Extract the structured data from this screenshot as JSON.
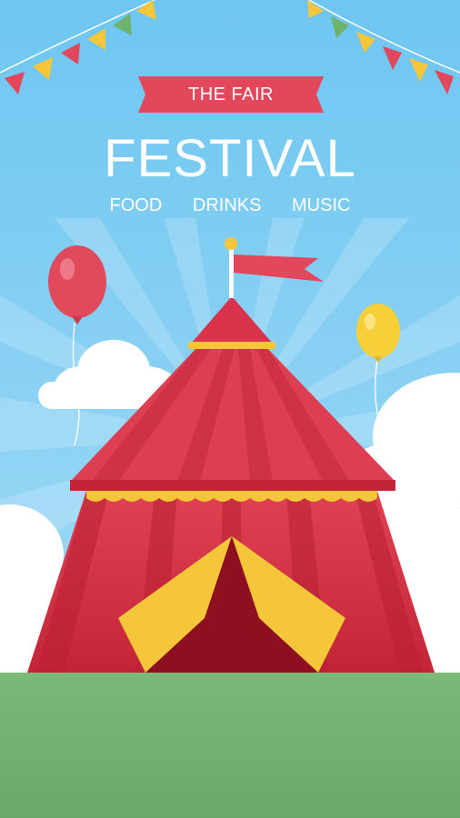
{
  "banner": {
    "label": "THE FAIR"
  },
  "headline": {
    "title": "FESTIVAL"
  },
  "taglines": [
    "FOOD",
    "DRINKS",
    "MUSIC"
  ],
  "colors": {
    "sky": "#6ec6f1",
    "grass": "#74b072",
    "tent_red": "#d8334a",
    "tent_yellow": "#f5c53a",
    "ribbon": "#e2475c",
    "balloon_red": "#e04a5c",
    "balloon_yellow": "#f7cf38"
  }
}
